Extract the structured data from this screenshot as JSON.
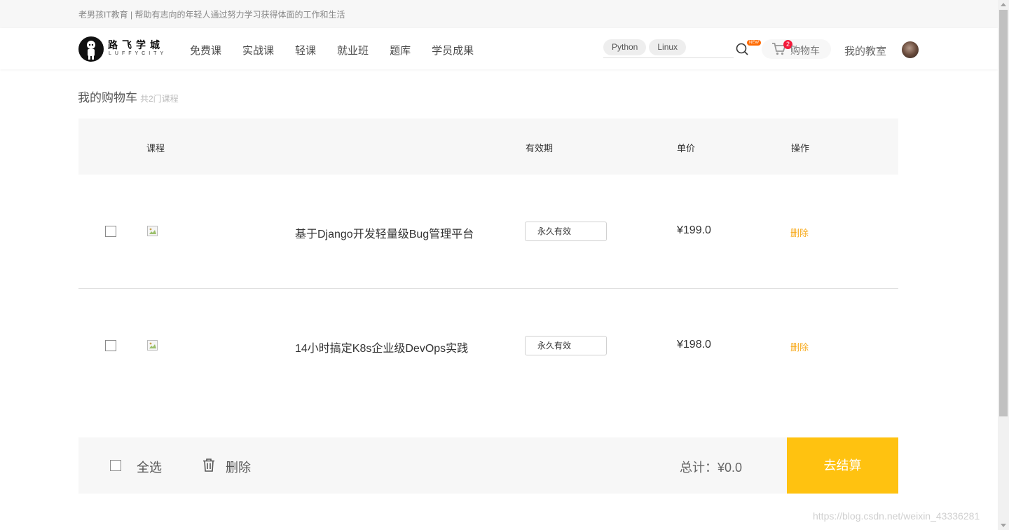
{
  "topbar": {
    "text": "老男孩IT教育 | 帮助有志向的年轻人通过努力学习获得体面的工作和生活"
  },
  "header": {
    "logo_cn": "路飞学城",
    "logo_en": "LUFFYCITY",
    "nav": [
      "免费课",
      "实战课",
      "轻课",
      "就业班",
      "题库",
      "学员成果"
    ],
    "search_tags": [
      "Python",
      "Linux"
    ],
    "new_badge": "NEW",
    "cart_count": "2",
    "cart_label": "购物车",
    "classroom": "我的教室"
  },
  "cart": {
    "title": "我的购物车",
    "subtitle": "共2门课程",
    "columns": {
      "course": "课程",
      "validity": "有效期",
      "price": "单价",
      "action": "操作"
    },
    "items": [
      {
        "name": "基于Django开发轻量级Bug管理平台",
        "validity": "永久有效",
        "price": "¥199.0",
        "action": "删除"
      },
      {
        "name": "14小时搞定K8s企业级DevOps实践",
        "validity": "永久有效",
        "price": "¥198.0",
        "action": "删除"
      }
    ],
    "footer": {
      "select_all": "全选",
      "delete": "删除",
      "total": "总计：¥0.0",
      "checkout": "去结算"
    }
  },
  "watermark": "https://blog.csdn.net/weixin_43336281",
  "colors": {
    "accent": "#ffc210",
    "delete_link": "#f8ab1e",
    "badge": "#f3193a",
    "new_badge": "#ff6a00"
  },
  "icons": [
    "search-icon",
    "cart-icon",
    "trash-icon",
    "broken-image-icon"
  ]
}
